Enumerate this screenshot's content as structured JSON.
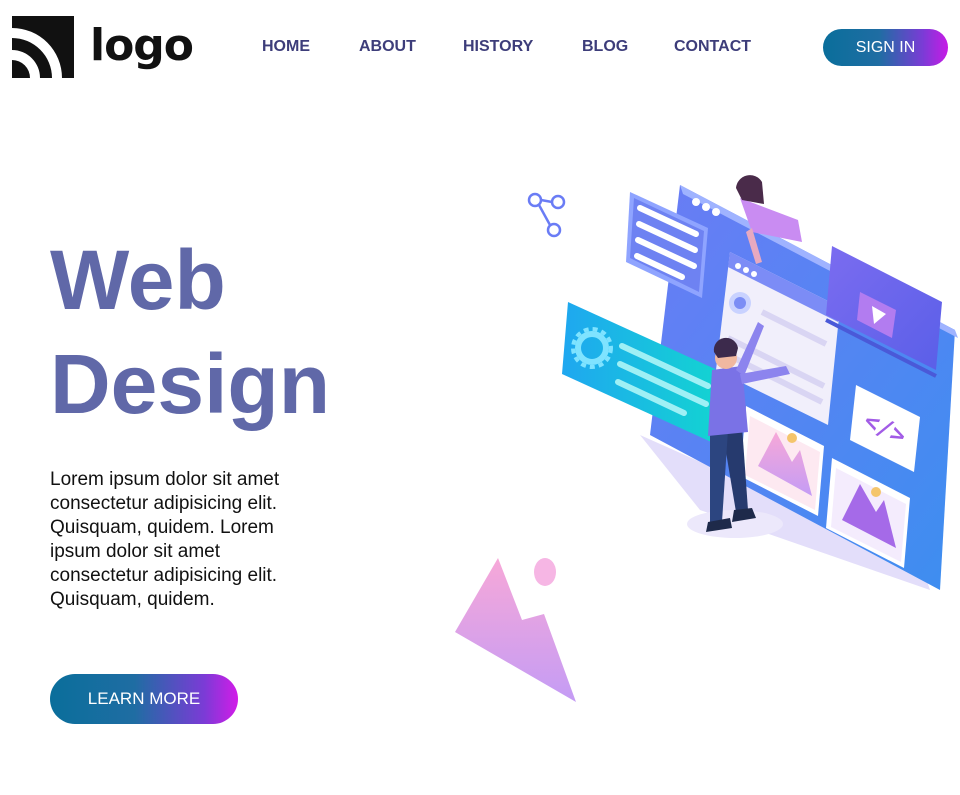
{
  "header": {
    "logo_text": "logo",
    "nav": [
      "HOME",
      "ABOUT",
      "HISTORY",
      "BLOG",
      "CONTACT"
    ],
    "signin_label": "SIGN IN"
  },
  "hero": {
    "title_line1": "Web",
    "title_line2": "Design",
    "body": "Lorem ipsum dolor sit amet consectetur adipisicing elit. Quisquam, quidem. Lorem ipsum dolor sit amet consectetur adipisicing elit. Quisquam, quidem.",
    "cta_label": "LEARN MORE"
  },
  "illustration": {
    "code_symbol": "</>",
    "icons": [
      "gear-icon",
      "share-icon",
      "image-icon",
      "play-icon",
      "code-icon"
    ]
  },
  "colors": {
    "accent_start": "#0a6e9b",
    "accent_end": "#c71be6",
    "title": "#6068a8",
    "nav": "#3d3d7a"
  }
}
